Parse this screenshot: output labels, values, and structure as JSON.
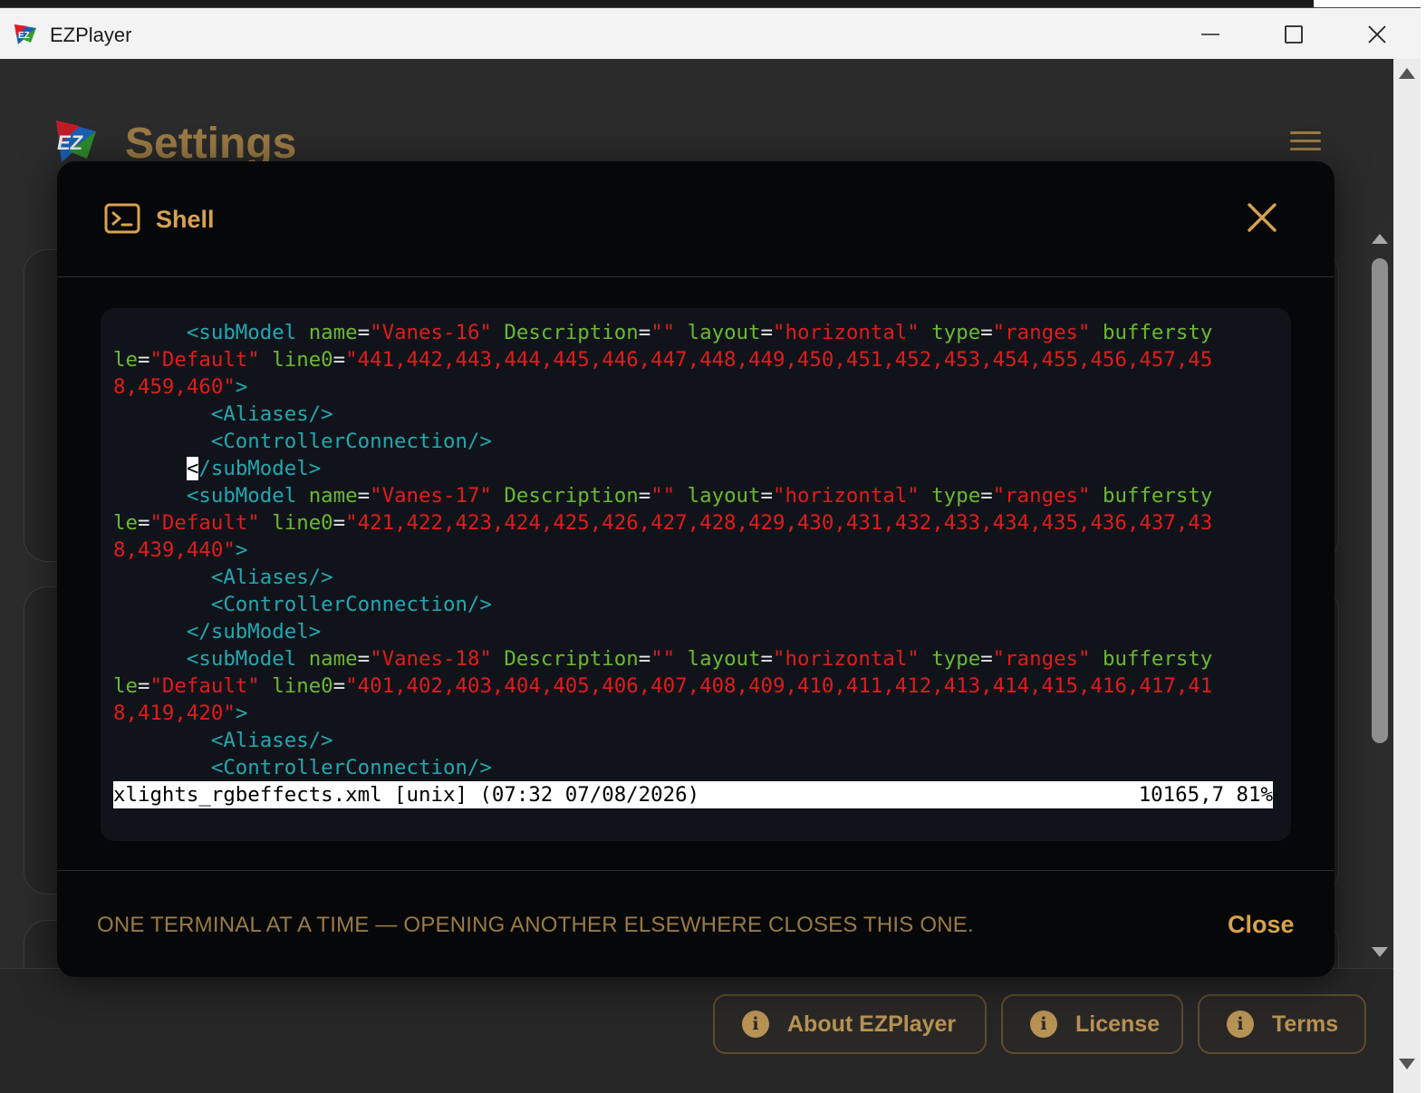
{
  "window": {
    "title": "EZPlayer",
    "minimize_glyph": "—",
    "maximize_glyph": "☐",
    "close_glyph": "✕"
  },
  "header": {
    "title": "Settings",
    "menu_icon": "hamburger-icon"
  },
  "modal": {
    "title": "Shell",
    "title_icon": "terminal-icon",
    "close_icon": "close-icon",
    "footer_note": "ONE TERMINAL AT A TIME — OPENING ANOTHER ELSEWHERE CLOSES THIS ONE.",
    "close_label": "Close"
  },
  "terminal": {
    "lines": [
      [
        [
          "",
          "      "
        ],
        [
          "tag",
          "<subModel "
        ],
        [
          "attr",
          "name"
        ],
        [
          "eq",
          "="
        ],
        [
          "str",
          "\"Vanes-16\" "
        ],
        [
          "attr",
          "Description"
        ],
        [
          "eq",
          "="
        ],
        [
          "str",
          "\"\" "
        ],
        [
          "attr",
          "layout"
        ],
        [
          "eq",
          "="
        ],
        [
          "str",
          "\"horizontal\" "
        ],
        [
          "attr",
          "type"
        ],
        [
          "eq",
          "="
        ],
        [
          "str",
          "\"ranges\" "
        ],
        [
          "attr",
          "buffersty"
        ]
      ],
      [
        [
          "attr",
          "le"
        ],
        [
          "eq",
          "="
        ],
        [
          "str",
          "\"Default\" "
        ],
        [
          "attr",
          "line0"
        ],
        [
          "eq",
          "="
        ],
        [
          "str",
          "\"441,442,443,444,445,446,447,448,449,450,451,452,453,454,455,456,457,45"
        ]
      ],
      [
        [
          "str",
          "8,459,460\""
        ],
        [
          "tag",
          ">"
        ]
      ],
      [
        [
          "",
          "        "
        ],
        [
          "tag",
          "<Aliases/>"
        ]
      ],
      [
        [
          "",
          "        "
        ],
        [
          "tag",
          "<ControllerConnection/>"
        ]
      ],
      [
        [
          "",
          "      "
        ],
        [
          "cursor",
          "<"
        ],
        [
          "tag",
          "/subModel>"
        ]
      ],
      [
        [
          "",
          "      "
        ],
        [
          "tag",
          "<subModel "
        ],
        [
          "attr",
          "name"
        ],
        [
          "eq",
          "="
        ],
        [
          "str",
          "\"Vanes-17\" "
        ],
        [
          "attr",
          "Description"
        ],
        [
          "eq",
          "="
        ],
        [
          "str",
          "\"\" "
        ],
        [
          "attr",
          "layout"
        ],
        [
          "eq",
          "="
        ],
        [
          "str",
          "\"horizontal\" "
        ],
        [
          "attr",
          "type"
        ],
        [
          "eq",
          "="
        ],
        [
          "str",
          "\"ranges\" "
        ],
        [
          "attr",
          "buffersty"
        ]
      ],
      [
        [
          "attr",
          "le"
        ],
        [
          "eq",
          "="
        ],
        [
          "str",
          "\"Default\" "
        ],
        [
          "attr",
          "line0"
        ],
        [
          "eq",
          "="
        ],
        [
          "str",
          "\"421,422,423,424,425,426,427,428,429,430,431,432,433,434,435,436,437,43"
        ]
      ],
      [
        [
          "str",
          "8,439,440\""
        ],
        [
          "tag",
          ">"
        ]
      ],
      [
        [
          "",
          "        "
        ],
        [
          "tag",
          "<Aliases/>"
        ]
      ],
      [
        [
          "",
          "        "
        ],
        [
          "tag",
          "<ControllerConnection/>"
        ]
      ],
      [
        [
          "",
          "      "
        ],
        [
          "tag",
          "</subModel>"
        ]
      ],
      [
        [
          "",
          "      "
        ],
        [
          "tag",
          "<subModel "
        ],
        [
          "attr",
          "name"
        ],
        [
          "eq",
          "="
        ],
        [
          "str",
          "\"Vanes-18\" "
        ],
        [
          "attr",
          "Description"
        ],
        [
          "eq",
          "="
        ],
        [
          "str",
          "\"\" "
        ],
        [
          "attr",
          "layout"
        ],
        [
          "eq",
          "="
        ],
        [
          "str",
          "\"horizontal\" "
        ],
        [
          "attr",
          "type"
        ],
        [
          "eq",
          "="
        ],
        [
          "str",
          "\"ranges\" "
        ],
        [
          "attr",
          "buffersty"
        ]
      ],
      [
        [
          "attr",
          "le"
        ],
        [
          "eq",
          "="
        ],
        [
          "str",
          "\"Default\" "
        ],
        [
          "attr",
          "line0"
        ],
        [
          "eq",
          "="
        ],
        [
          "str",
          "\"401,402,403,404,405,406,407,408,409,410,411,412,413,414,415,416,417,41"
        ]
      ],
      [
        [
          "str",
          "8,419,420\""
        ],
        [
          "tag",
          ">"
        ]
      ],
      [
        [
          "",
          "        "
        ],
        [
          "tag",
          "<Aliases/>"
        ]
      ],
      [
        [
          "",
          "        "
        ],
        [
          "tag",
          "<ControllerConnection/>"
        ]
      ]
    ],
    "status_left": "xlights_rgbeffects.xml [unix] (07:32 07/08/2026)",
    "status_right": "10165,7 81%"
  },
  "footer": {
    "buttons": [
      {
        "label": "About EZPlayer",
        "icon": "info-icon"
      },
      {
        "label": "License",
        "icon": "info-icon"
      },
      {
        "label": "Terms",
        "icon": "info-icon"
      }
    ],
    "info_glyph": "i"
  },
  "colors": {
    "accent": "#d7a24f",
    "accent_dim": "#9b7a45",
    "tag": "#25a6b0",
    "attr": "#6cb833",
    "string": "#e01c1c"
  }
}
